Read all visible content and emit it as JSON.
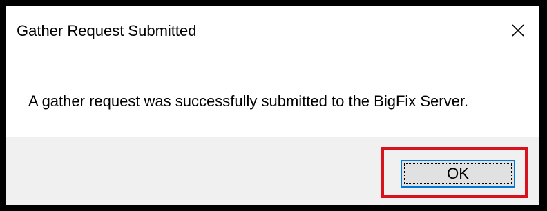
{
  "dialog": {
    "title": "Gather Request Submitted",
    "close_icon": "close-icon",
    "message": "A gather request was successfully submitted to the BigFix Server.",
    "ok_label": "OK"
  },
  "colors": {
    "highlight_border": "#d8121c",
    "button_focus_border": "#0078d7",
    "footer_background": "#f0f0f0",
    "window_frame": "#000000"
  }
}
